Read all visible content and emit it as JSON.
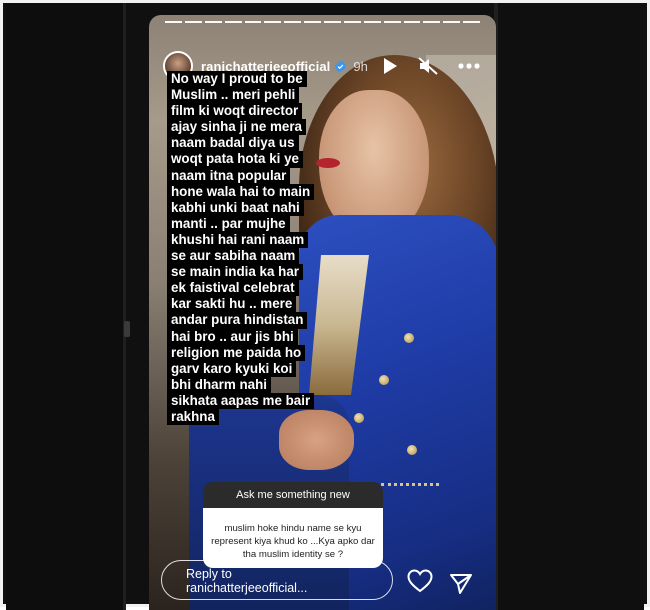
{
  "story": {
    "username": "ranichatterjeeofficial",
    "time": "9h",
    "progress_segments": 16,
    "caption_lines": [
      "No way I proud to be",
      "Muslim ..  meri pehli",
      "film ki woqt director",
      "ajay sinha ji ne mera",
      "naam badal diya us",
      "woqt pata hota ki ye",
      "naam itna popular",
      "hone wala hai to main",
      "kabhi unki baat nahi",
      "manti .. par mujhe",
      "khushi hai rani naam",
      "se aur sabiha naam",
      "se main india ka har",
      "ek faistival celebrat",
      "kar sakti hu .. mere",
      "andar pura hindistan",
      "hai bro .. aur jis bhi",
      "religion me paida ho",
      "garv karo kyuki koi",
      "bhi dharm nahi",
      "sikhata aapas me bair",
      "rakhna"
    ],
    "question_sticker": {
      "title": "Ask me something new",
      "question": "muslim hoke hindu name se kyu represent kiya khud ko ...Kya apko dar tha muslim identity se ?"
    },
    "reply_placeholder_line1": "Reply to",
    "reply_placeholder_line2": "ranichatterjeeofficial..."
  },
  "icons": {
    "verified": "verified-badge-icon",
    "play": "play-icon",
    "mute": "speaker-muted-icon",
    "more": "more-options-icon",
    "like": "heart-icon",
    "share": "send-icon"
  },
  "colors": {
    "verified": "#3897f0",
    "text_bg": "#000000",
    "background": "#101010"
  }
}
